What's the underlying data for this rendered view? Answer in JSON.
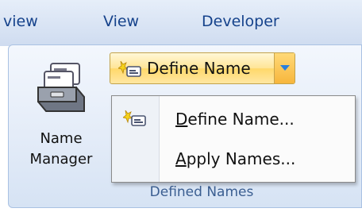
{
  "tabs": {
    "review": "view",
    "view": "View",
    "developer": "Developer"
  },
  "ribbon": {
    "name_manager": {
      "line1": "Name",
      "line2": "Manager",
      "icon": "card-file-icon"
    },
    "define_name_button": {
      "label": "Define Name",
      "icon": "define-name-icon",
      "arrow_icon": "chevron-down-icon"
    },
    "group_label": "Defined Names"
  },
  "menu": {
    "items": [
      {
        "accel": "D",
        "rest": "efine Name...",
        "icon": "define-name-icon"
      },
      {
        "accel": "A",
        "rest": "pply Names...",
        "icon": ""
      }
    ]
  },
  "colors": {
    "tab_text": "#15428b",
    "highlight": "#ffe596",
    "arrow": "#2a7fdc"
  }
}
